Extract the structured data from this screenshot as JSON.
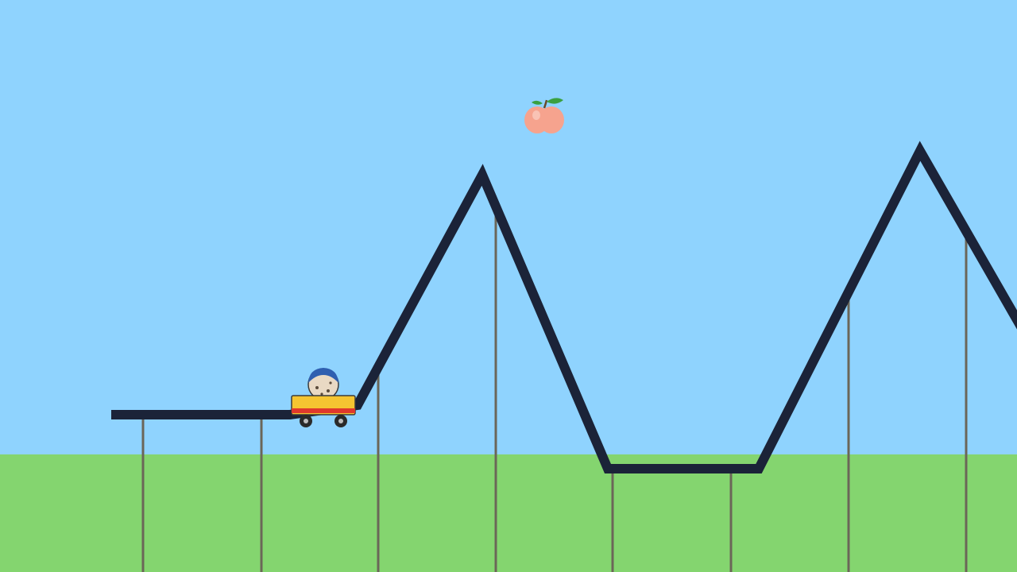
{
  "scene": {
    "title": "",
    "sky_color": "#8fd3fe",
    "ground_color": "#84d56f",
    "track_color": "#1b2338",
    "support_color": "#6b6658"
  },
  "collectible": {
    "icon": "peach-icon",
    "fruit_color": "#f6a38e",
    "leaf_color": "#3aa040"
  },
  "player": {
    "icon": "rider-in-cart-icon",
    "cart_color": "#f5c531",
    "stripe_color": "#e0382c",
    "helmet_color": "#2f5fb0"
  }
}
